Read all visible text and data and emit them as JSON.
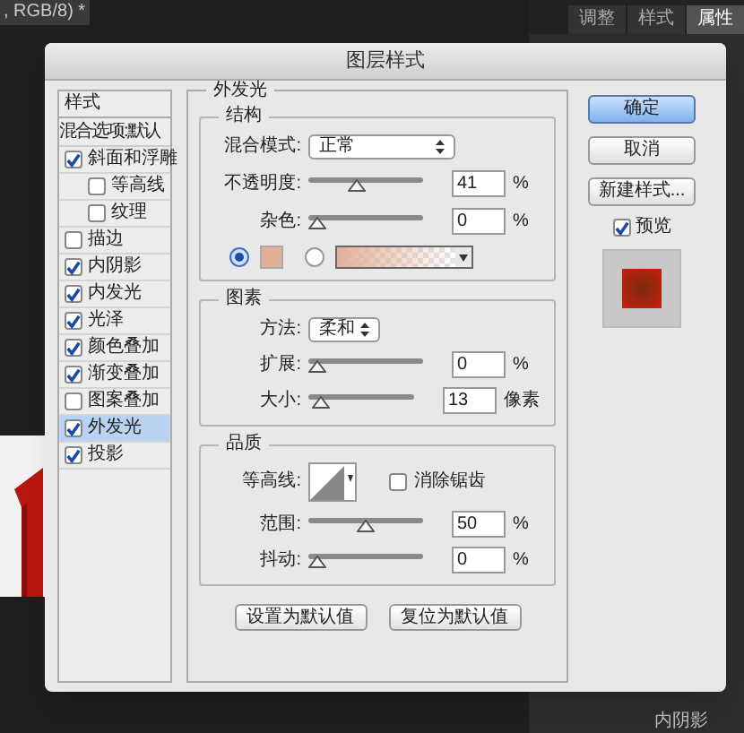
{
  "background": {
    "doc_tab": ", RGB/8) *",
    "panel_tabs": [
      {
        "label": "调整",
        "selected": false
      },
      {
        "label": "样式",
        "selected": false
      },
      {
        "label": "属性",
        "selected": true
      }
    ],
    "layer_item": "内阴影"
  },
  "dialog": {
    "title": "图层样式",
    "sidebar": {
      "header": "样式",
      "blend_options": "混合选项:默认",
      "items": [
        {
          "label": "斜面和浮雕",
          "checked": true,
          "selected": false,
          "children": [
            {
              "label": "等高线",
              "checked": false,
              "selected": false
            },
            {
              "label": "纹理",
              "checked": false,
              "selected": false
            }
          ]
        },
        {
          "label": "描边",
          "checked": false,
          "selected": false
        },
        {
          "label": "内阴影",
          "checked": true,
          "selected": false
        },
        {
          "label": "内发光",
          "checked": true,
          "selected": false
        },
        {
          "label": "光泽",
          "checked": true,
          "selected": false
        },
        {
          "label": "颜色叠加",
          "checked": true,
          "selected": false
        },
        {
          "label": "渐变叠加",
          "checked": true,
          "selected": false
        },
        {
          "label": "图案叠加",
          "checked": false,
          "selected": false
        },
        {
          "label": "外发光",
          "checked": true,
          "selected": true
        },
        {
          "label": "投影",
          "checked": true,
          "selected": false
        }
      ]
    },
    "panel": {
      "title": "外发光",
      "structure": {
        "title": "结构",
        "blend_mode": {
          "label": "混合模式:",
          "value": "正常"
        },
        "opacity": {
          "label": "不透明度:",
          "level": 0.41,
          "value": "41",
          "unit": "%"
        },
        "noise": {
          "label": "杂色:",
          "level": 0,
          "value": "0",
          "unit": "%"
        },
        "fill": {
          "solid_selected": true,
          "color": "#e2b09a"
        }
      },
      "elements": {
        "title": "图素",
        "technique": {
          "label": "方法:",
          "value": "柔和"
        },
        "spread": {
          "label": "扩展:",
          "level": 0,
          "value": "0",
          "unit": "%"
        },
        "size": {
          "label": "大小:",
          "level": 0.05,
          "value": "13",
          "unit": "像素"
        }
      },
      "quality": {
        "title": "品质",
        "contour_label": "等高线:",
        "anti_alias": {
          "label": "消除锯齿",
          "checked": false
        },
        "range": {
          "label": "范围:",
          "level": 0.5,
          "value": "50",
          "unit": "%"
        },
        "jitter": {
          "label": "抖动:",
          "level": 0,
          "value": "0",
          "unit": "%"
        }
      },
      "buttons": [
        "设置为默认值",
        "复位为默认值"
      ]
    },
    "buttons": [
      {
        "label": "确定",
        "kind": "primary"
      },
      {
        "label": "取消",
        "kind": "normal"
      },
      {
        "label": "新建样式...",
        "kind": "normal"
      }
    ],
    "preview": {
      "label": "预览",
      "checked": true
    }
  }
}
